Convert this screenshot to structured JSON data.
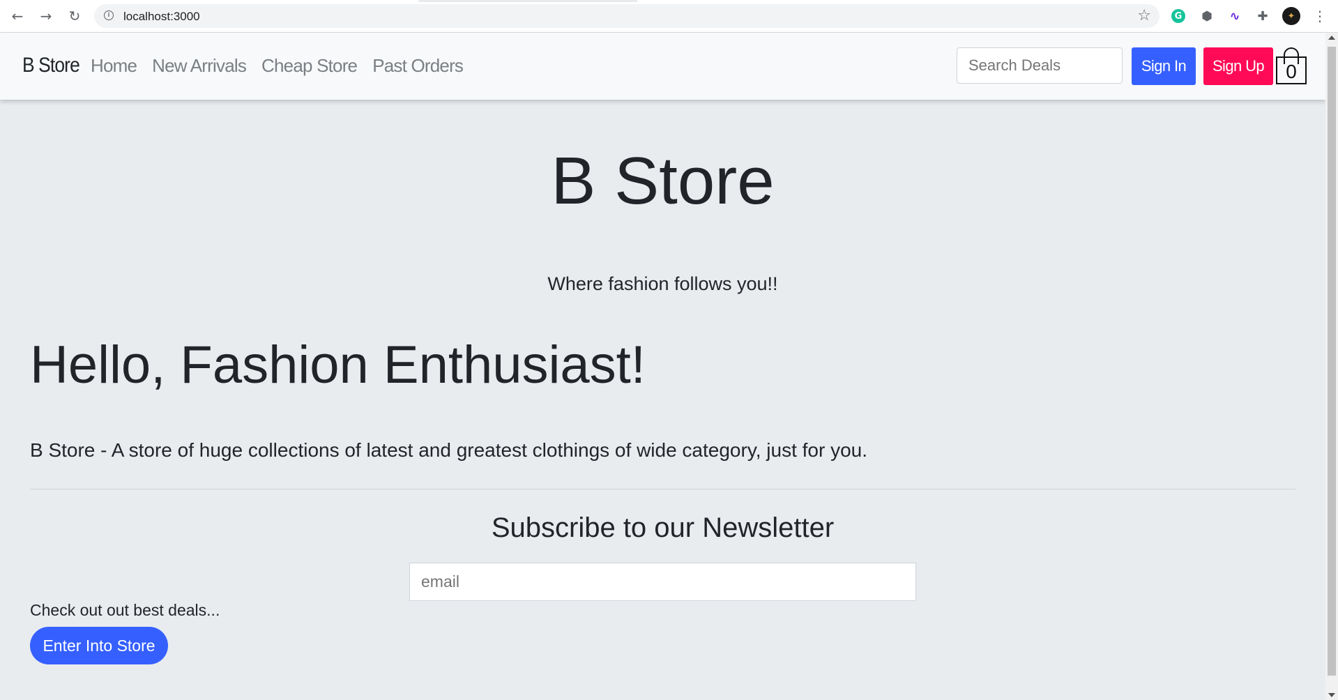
{
  "browser": {
    "back_icon": "←",
    "forward_icon": "→",
    "reload_icon": "↻",
    "url": "localhost:3000",
    "info_icon": "i",
    "star_icon": "☆",
    "extensions": {
      "grammarly": "G",
      "cube": "⬢",
      "wave": "∿",
      "puzzle": "✚",
      "avatar": "✦",
      "menu": "⋮"
    }
  },
  "navbar": {
    "brand": "B Store",
    "links": [
      "Home",
      "New Arrivals",
      "Cheap Store",
      "Past Orders"
    ],
    "search_placeholder": "Search Deals",
    "sign_in_label": "Sign In",
    "sign_up_label": "Sign Up",
    "cart_count": "0"
  },
  "hero": {
    "title": "B Store",
    "subtitle": "Where fashion follows you!!"
  },
  "jumbotron": {
    "heading": "Hello, Fashion Enthusiast!",
    "lead": "B Store - A store of huge collections of latest and greatest clothings of wide category, just for you."
  },
  "newsletter": {
    "title": "Subscribe to our Newsletter",
    "email_placeholder": "email"
  },
  "deals": {
    "text": "Check out out best deals...",
    "button_label": "Enter Into Store"
  },
  "colors": {
    "primary": "#3560ff",
    "danger": "#ff0a57",
    "page_background": "#e9ecef",
    "navbar_background": "#f8f9fa"
  }
}
